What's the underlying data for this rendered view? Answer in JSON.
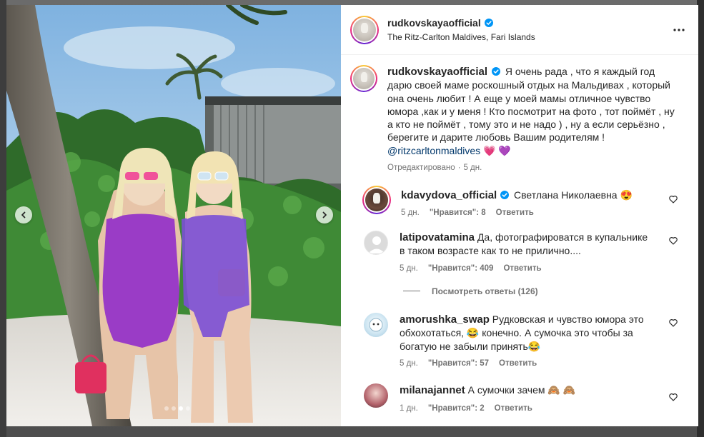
{
  "colors": {
    "text": "#262626",
    "muted": "#737373",
    "mention": "#00376b",
    "verified": "#0095f6",
    "heart_emoji": "#ff5fa2",
    "purple_heart": "#8f4fd8"
  },
  "post": {
    "author": "rudkovskayaofficial",
    "location": "The Ritz-Carlton Maldives, Fari Islands",
    "more_icon": "more-horizontal-icon",
    "carousel": {
      "dots": 4,
      "active_dot": 3
    }
  },
  "caption": {
    "username": "rudkovskayaofficial",
    "text": "Я очень рада , что я каждый год дарю своей маме роскошный отдых на Мальдивах , который она очень любит ! А еще у моей мамы отличное чувство юмора ,как и у меня ! Кто посмотрит на фото , тот поймёт , ну а кто не поймёт , тому это и не надо ) , ну а если серьёзно , берегите и дарите любовь Вашим родителям !",
    "mention": "@ritzcarltonmaldives",
    "emojis": "💗 💜",
    "edited": "Отредактировано",
    "time": "5 дн."
  },
  "comments": [
    {
      "username": "kdavydova_official",
      "verified": true,
      "text": "Светлана Николаевна 😍",
      "time": "5 дн.",
      "likes": "\"Нравится\": 8",
      "reply": "Ответить"
    },
    {
      "username": "latipovatamina",
      "verified": false,
      "text": "Да, фотографироватся в купальнике в таком возрасте как то не прилично....",
      "time": "5 дн.",
      "likes": "\"Нравится\": 409",
      "reply": "Ответить"
    },
    {
      "username": "amorushka_swap",
      "verified": false,
      "text": "Рудковская и чувство юмора это обхохотаться, 😂 конечно. А сумочка это чтобы за богатую не забыли принять😂",
      "time": "5 дн.",
      "likes": "\"Нравится\": 57",
      "reply": "Ответить"
    },
    {
      "username": "milanajannet",
      "verified": false,
      "text": "А сумочки зачем 🙈 🙈",
      "time": "1 дн.",
      "likes": "\"Нравится\": 2",
      "reply": "Ответить"
    }
  ],
  "view_replies": "Посмотреть ответы (126)"
}
